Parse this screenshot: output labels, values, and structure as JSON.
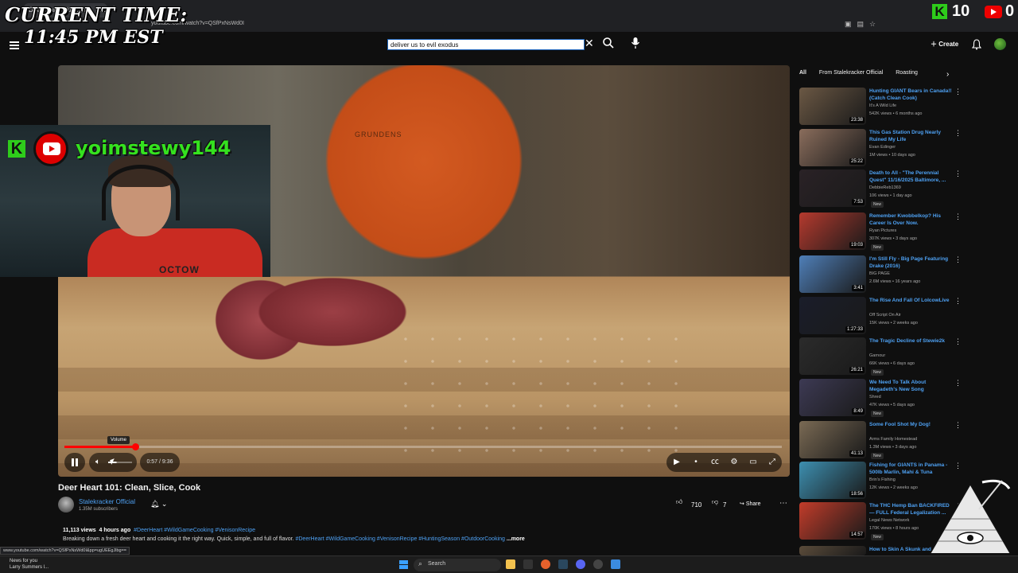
{
  "browser": {
    "tab_title": "Deer Heart 101: Clean, Slice, Cook",
    "url": "youtube.com/watch?v=QSfPxNsWd0I",
    "status_url": "www.youtube.com/watch?v=QSfPxNsWd0I&pp=ugUEEgJlbg=="
  },
  "overlay": {
    "clock_label": "CURRENT TIME:",
    "clock_time": "11:45 PM EST",
    "kick_viewers": "10",
    "youtube_viewers": "0",
    "streamer_name": "yoimstewy144",
    "shirt_text": "OCTOW"
  },
  "header": {
    "search_value": "deliver us to evil exodus",
    "create_label": "Create"
  },
  "player": {
    "apron_brand": "GRUNDENS",
    "volume_tooltip": "Volume",
    "time_display": "0:57 / 9:36",
    "progress": 0.099,
    "volume_level": 0.35
  },
  "video": {
    "title": "Deer Heart 101: Clean, Slice, Cook",
    "channel": "Stalekracker Official",
    "subscribers": "1.35M subscribers",
    "likes": "710",
    "dislikes": "7",
    "share_label": "Share",
    "views": "11,113 views",
    "age": "4 hours ago",
    "top_tags": "#DeerHeart #WildGameCooking #VenisonRecipe",
    "description": "Breaking down a fresh deer heart and cooking it the right way. Quick, simple, and full of flavor.",
    "desc_tags": "#DeerHeart #WildGameCooking #VenisonRecipe #HuntingSeason #OutdoorCooking",
    "more_label": "...more"
  },
  "sidebar": {
    "chips": [
      "All",
      "From Stalekracker Official",
      "Roasting"
    ],
    "recommendations": [
      {
        "title": "Hunting GIANT Bears in Canada!! (Catch Clean Cook)",
        "channel": "It's A Wild Life",
        "meta": "542K views • 6 months ago",
        "duration": "23:38",
        "new": "",
        "thumb": "#6b5844"
      },
      {
        "title": "This Gas Station Drug Nearly Ruined My Life",
        "channel": "Evan Edinger",
        "meta": "1M views • 10 days ago",
        "duration": "25:22",
        "new": "",
        "thumb": "#8a6d5c"
      },
      {
        "title": "Death to All - \"The Perennial Quest\" 11/16/2025 Baltimore, ...",
        "channel": "DebbieReb1369",
        "meta": "106 views • 1 day ago",
        "duration": "7:53",
        "new": "New",
        "thumb": "#2a2226"
      },
      {
        "title": "Remember Kwobbelkop? His Career Is Over Now.",
        "channel": "Ryan Pictures",
        "meta": "307K views • 3 days ago",
        "duration": "19:03",
        "new": "New",
        "thumb": "#b53a2e"
      },
      {
        "title": "I'm Still Fly - Big Page Featuring Drake (2016)",
        "channel": "BIG PAGE",
        "meta": "2.6M views • 16 years ago",
        "duration": "3:41",
        "new": "",
        "thumb": "#4f7fb8"
      },
      {
        "title": "The Rise And Fall Of LolcowLive",
        "channel": "Off Script On Air",
        "meta": "15K views • 2 weeks ago",
        "duration": "1:27:33",
        "new": "",
        "thumb": "#1a1d2a"
      },
      {
        "title": "The Tragic Decline of Stewie2k",
        "channel": "Garnour",
        "meta": "66K views • 6 days ago",
        "duration": "26:21",
        "new": "New",
        "thumb": "#2b2b2b"
      },
      {
        "title": "We Need To Talk About Megadeth's New Song",
        "channel": "Shred",
        "meta": "47K views • 5 days ago",
        "duration": "8:49",
        "new": "New",
        "thumb": "#3d3a54"
      },
      {
        "title": "Some Fool Shot My Dog!",
        "channel": "Arms Family Homestead",
        "meta": "1.3M views • 3 days ago",
        "duration": "41:13",
        "new": "New",
        "thumb": "#7a6a54"
      },
      {
        "title": "Fishing for GIANTS in Panama - 500lb Marlin, Mahi & Tuna",
        "channel": "Brin's Fishing",
        "meta": "12K views • 2 weeks ago",
        "duration": "18:56",
        "new": "",
        "thumb": "#3d8fb0"
      },
      {
        "title": "The THC Hemp Ban BACKFIRED — FULL Federal Legalization ...",
        "channel": "Legal News Network",
        "meta": "170K views • 8 hours ago",
        "duration": "14:57",
        "new": "New",
        "thumb": "#c23c2a"
      },
      {
        "title": "How to Skin A Skunk and",
        "channel": "",
        "meta": "",
        "duration": "",
        "new": "",
        "thumb": "#5a4b3a"
      }
    ]
  },
  "taskbar": {
    "news_title": "News for you",
    "news_sub": "Larry Summers l...",
    "search_label": "Search"
  }
}
